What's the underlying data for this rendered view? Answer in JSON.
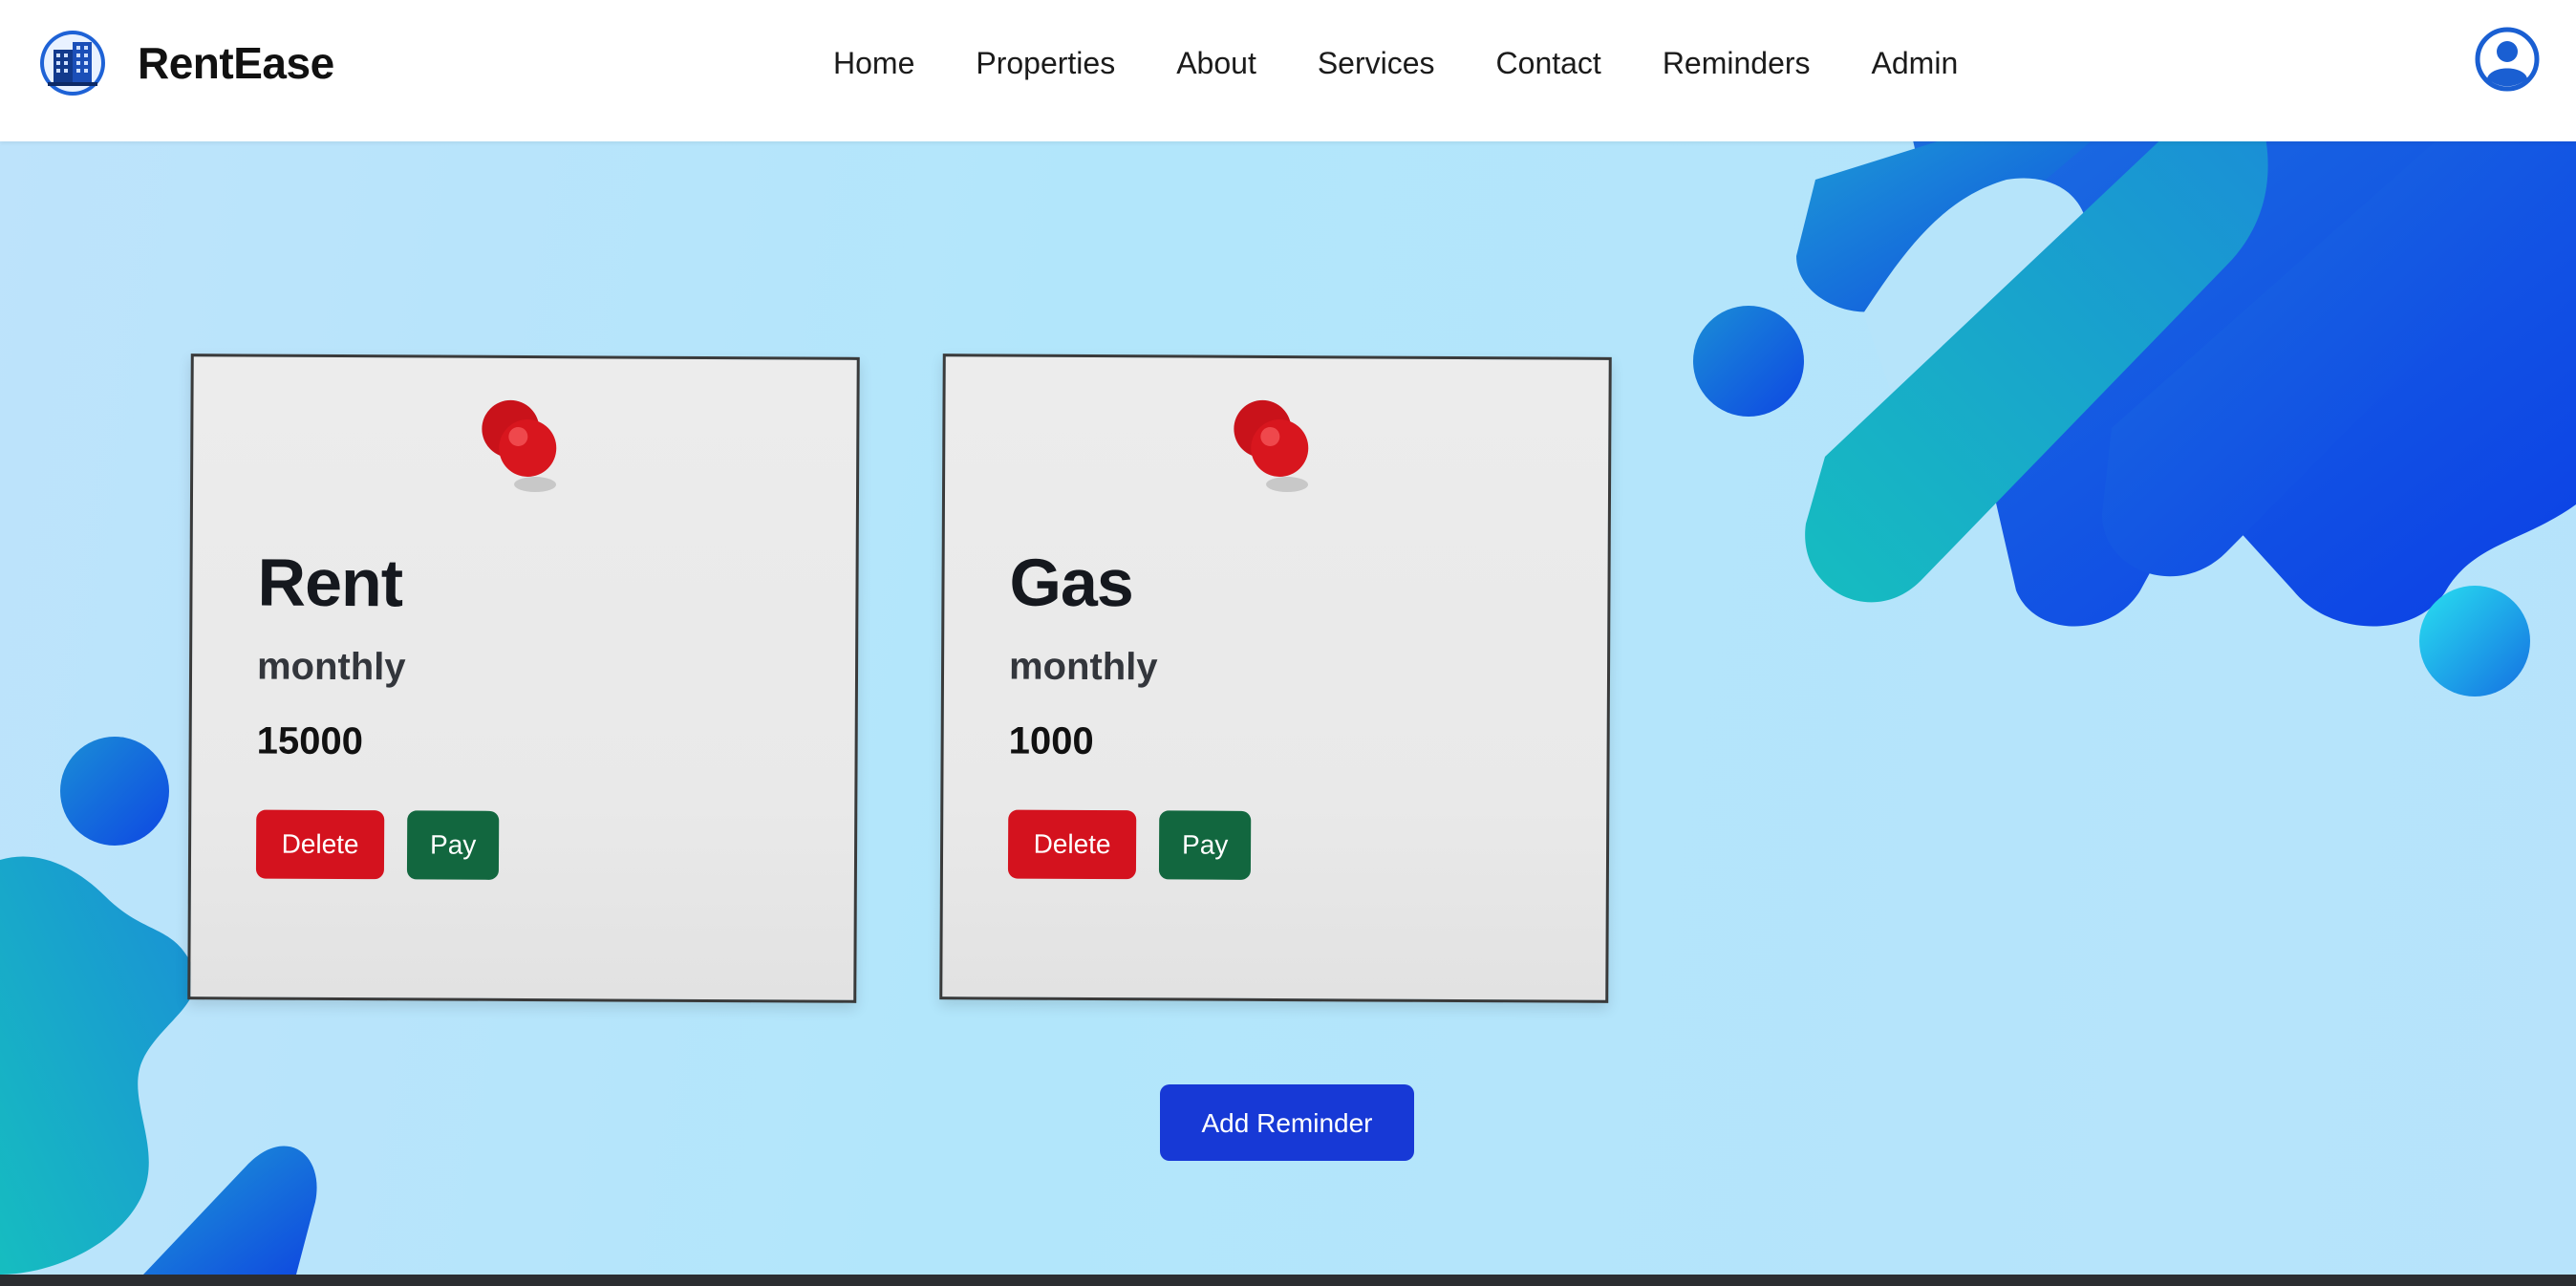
{
  "brand": {
    "name": "RentEase",
    "logo_icon": "building-logo-icon"
  },
  "nav": {
    "items": [
      {
        "label": "Home"
      },
      {
        "label": "Properties"
      },
      {
        "label": "About"
      },
      {
        "label": "Services"
      },
      {
        "label": "Contact"
      },
      {
        "label": "Reminders"
      },
      {
        "label": "Admin"
      }
    ],
    "user_icon": "user-account-icon"
  },
  "reminders": [
    {
      "title": "Rent",
      "frequency": "monthly",
      "amount": "15000",
      "delete_label": "Delete",
      "pay_label": "Pay"
    },
    {
      "title": "Gas",
      "frequency": "monthly",
      "amount": "1000",
      "delete_label": "Delete",
      "pay_label": "Pay"
    }
  ],
  "actions": {
    "add_label": "Add Reminder"
  },
  "colors": {
    "delete": "#d4121e",
    "pay": "#12673f",
    "primary": "#1739d6",
    "pin": "#d21a1a"
  }
}
